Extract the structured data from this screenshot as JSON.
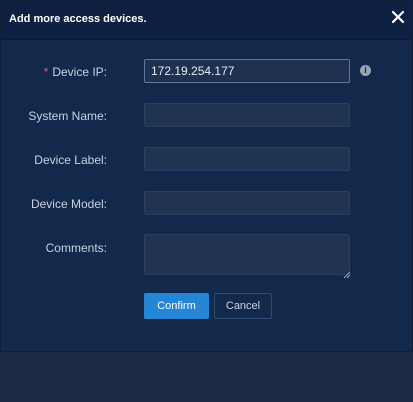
{
  "dialog": {
    "title": "Add more access devices.",
    "close_icon": "close-icon"
  },
  "form": {
    "required_mark": "*",
    "device_ip": {
      "label": "Device IP:",
      "value": "172.19.254.177",
      "info_icon": "info-icon"
    },
    "system_name": {
      "label": "System Name:",
      "value": ""
    },
    "device_label": {
      "label": "Device Label:",
      "value": ""
    },
    "device_model": {
      "label": "Device Model:",
      "value": ""
    },
    "comments": {
      "label": "Comments:",
      "value": ""
    }
  },
  "buttons": {
    "confirm": "Confirm",
    "cancel": "Cancel"
  },
  "colors": {
    "background": "#13294b",
    "primary": "#2586d8",
    "required": "#e05866"
  }
}
